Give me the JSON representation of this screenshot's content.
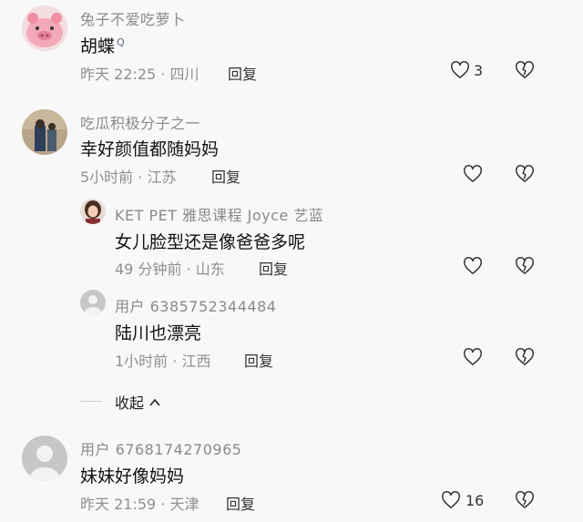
{
  "comments": [
    {
      "username": "兔子不爱吃萝卜",
      "text": "胡蝶",
      "search_marker": "Q",
      "time": "昨天 22:25",
      "location": "四川",
      "reply_label": "回复",
      "like_count": "3"
    },
    {
      "username": "吃瓜积极分子之一",
      "text": "幸好颜值都随妈妈",
      "time": "5小时前",
      "location": "江苏",
      "reply_label": "回复"
    },
    {
      "username": "KET PET 雅思课程 Joyce 艺蓝",
      "text": "女儿脸型还是像爸爸多呢",
      "time": "49 分钟前",
      "location": "山东",
      "reply_label": "回复"
    },
    {
      "username": "用户 6385752344484",
      "text": "陆川也漂亮",
      "time": "1小时前",
      "location": "江西",
      "reply_label": "回复"
    },
    {
      "username": "用户 6768174270965",
      "text": "妹妹好像妈妈",
      "time": "昨天 21:59",
      "location": "天津",
      "reply_label": "回复",
      "like_count": "16"
    }
  ],
  "collapse_label": "收起",
  "icons": [
    "heart-outline-icon",
    "heart-broken-icon",
    "chevron-up-icon",
    "default-avatar-icon"
  ]
}
